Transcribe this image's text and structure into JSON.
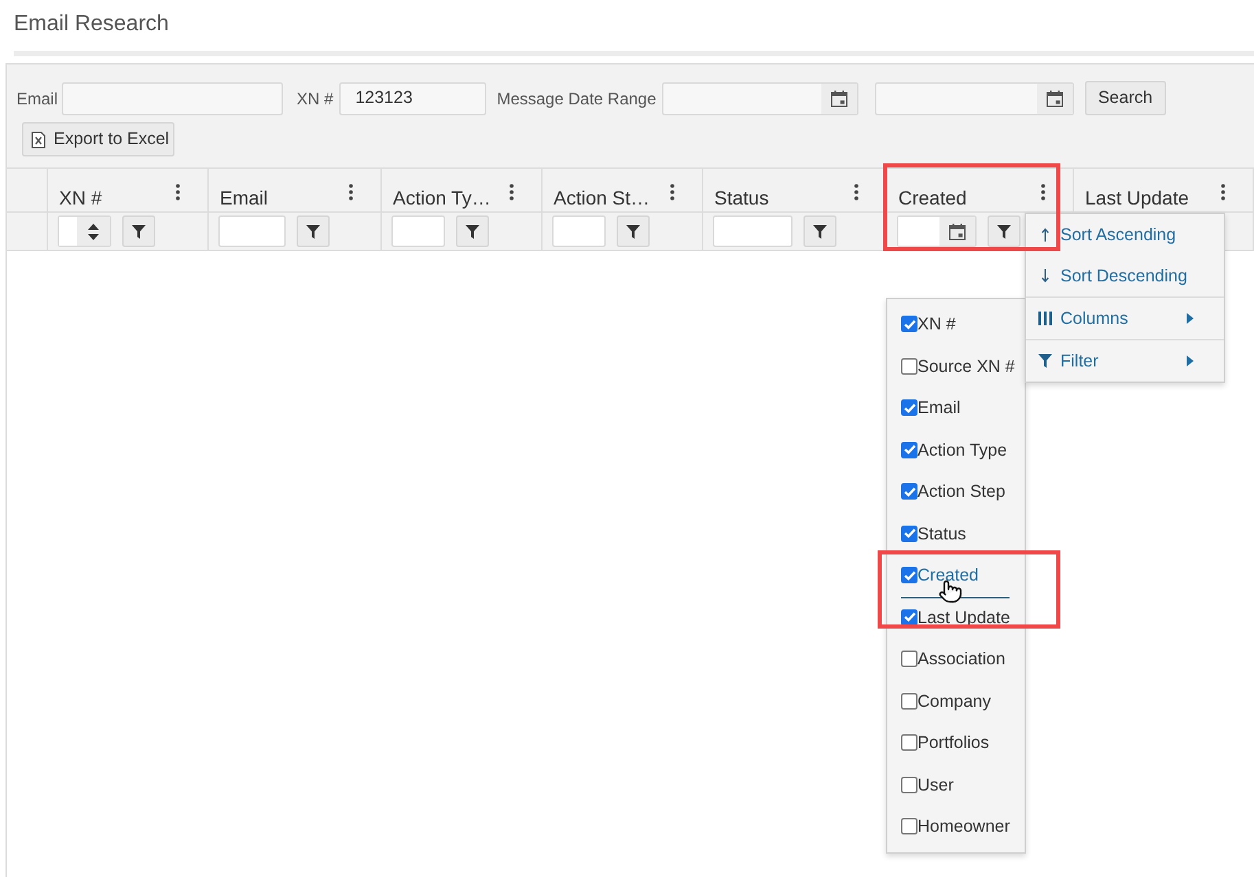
{
  "page": {
    "title": "Email Research"
  },
  "toolbar": {
    "fields": [
      {
        "kind": "text",
        "label": "Email"
      },
      {
        "kind": "text",
        "label": "XN #",
        "value": "123123"
      },
      {
        "kind": "date",
        "label": "Message Date Range"
      },
      {
        "kind": "date"
      }
    ],
    "search_button": "Search",
    "export_button": "Export to Excel"
  },
  "grid": {
    "columns": [
      {
        "label": "XN #",
        "filter": {
          "kind": "number"
        }
      },
      {
        "label": "Email",
        "filter": {
          "kind": "text"
        }
      },
      {
        "label": "Action Ty…",
        "filter": {
          "kind": "text"
        }
      },
      {
        "label": "Action St…",
        "filter": {
          "kind": "text"
        }
      },
      {
        "label": "Status",
        "filter": {
          "kind": "text"
        }
      },
      {
        "label": "Created",
        "filter": {
          "kind": "date"
        }
      },
      {
        "label": "Last Update"
      }
    ]
  },
  "column_menu": {
    "items": [
      {
        "kind": "sort-asc",
        "label": "Sort Ascending"
      },
      {
        "kind": "sort-desc",
        "label": "Sort Descending"
      },
      {
        "kind": "columns",
        "label": "Columns"
      },
      {
        "kind": "filter",
        "label": "Filter"
      }
    ]
  },
  "columns_submenu": {
    "items": [
      {
        "label": "XN #",
        "checked": true,
        "hovered": false
      },
      {
        "label": "Source XN #",
        "checked": false,
        "hovered": false
      },
      {
        "label": "Email",
        "checked": true,
        "hovered": false
      },
      {
        "label": "Action Type",
        "checked": true,
        "hovered": false
      },
      {
        "label": "Action Step",
        "checked": true,
        "hovered": false
      },
      {
        "label": "Status",
        "checked": true,
        "hovered": false
      },
      {
        "label": "Created",
        "checked": true,
        "hovered": true
      },
      {
        "label": "Last Update",
        "checked": true,
        "hovered": false
      },
      {
        "label": "Association",
        "checked": false,
        "hovered": false
      },
      {
        "label": "Company",
        "checked": false,
        "hovered": false
      },
      {
        "label": "Portfolios",
        "checked": false,
        "hovered": false
      },
      {
        "label": "User",
        "checked": false,
        "hovered": false
      },
      {
        "label": "Homeowner",
        "checked": false,
        "hovered": false
      }
    ]
  }
}
